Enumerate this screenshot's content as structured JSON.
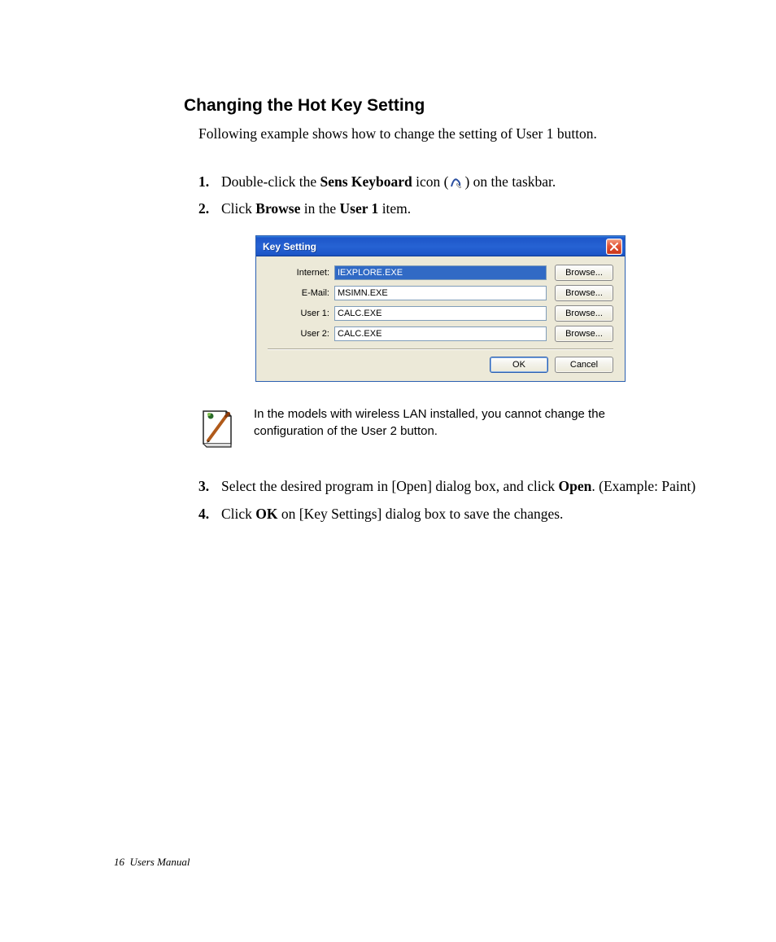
{
  "heading": "Changing the Hot Key Setting",
  "intro": "Following example shows how to change the setting of User 1 button.",
  "steps": {
    "s1": {
      "num": "1.",
      "pre": "Double-click the ",
      "bold1": "Sens Keyboard",
      "mid": " icon (",
      "post": ") on the taskbar."
    },
    "s2": {
      "num": "2.",
      "pre": "Click ",
      "bold1": "Browse",
      "mid": " in the ",
      "bold2": "User 1",
      "post": " item."
    },
    "s3": {
      "num": "3.",
      "pre": "Select the desired program in [Open] dialog box, and click ",
      "bold1": "Open",
      "post": ". (Example: Paint)"
    },
    "s4": {
      "num": "4.",
      "pre": "Click ",
      "bold1": "OK",
      "post": " on [Key Settings] dialog box to save the changes."
    }
  },
  "dialog": {
    "title": "Key Setting",
    "rows": [
      {
        "label": "Internet:",
        "value": "IEXPLORE.EXE",
        "btn": "Browse...",
        "selected": true
      },
      {
        "label": "E-Mail:",
        "value": "MSIMN.EXE",
        "btn": "Browse..."
      },
      {
        "label": "User 1:",
        "value": "CALC.EXE",
        "btn": "Browse..."
      },
      {
        "label": "User 2:",
        "value": "CALC.EXE",
        "btn": "Browse..."
      }
    ],
    "ok": "OK",
    "cancel": "Cancel"
  },
  "note": "In the models with wireless LAN installed, you cannot change the configuration of the User 2 button.",
  "footer_page": "16",
  "footer_label": "Users Manual"
}
